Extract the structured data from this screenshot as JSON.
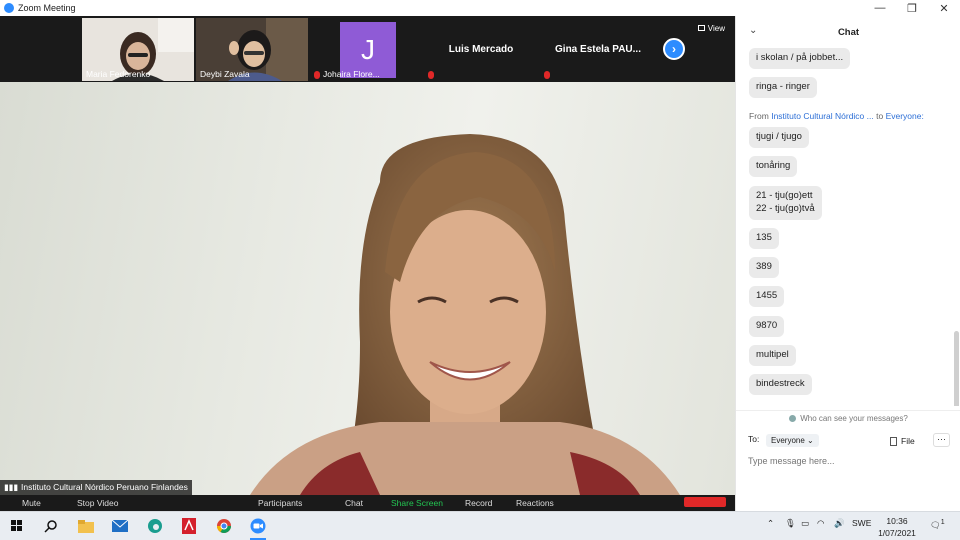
{
  "window": {
    "title": "Zoom Meeting",
    "minimize": "—",
    "restore": "❐",
    "close": "✕"
  },
  "thumbnails": [
    {
      "name": "Maria Fedorenko"
    },
    {
      "name": "Deybi Zavala"
    },
    {
      "name": "Johaira Flore...",
      "initial": "J"
    },
    {
      "name": "Luis Mercado"
    },
    {
      "name": "Gina Estela PAU..."
    }
  ],
  "view_label": "View",
  "speaker_name": "Instituto Cultural Nórdico Peruano Finlandes",
  "toolbar": {
    "mute": "Mute",
    "stop_video": "Stop Video",
    "participants": "Participants",
    "chat": "Chat",
    "share_screen": "Share Screen",
    "record": "Record",
    "reactions": "Reactions"
  },
  "chat": {
    "title": "Chat",
    "messages_top": [
      "i skolan / på jobbet...",
      "ringa - ringer"
    ],
    "from_prefix": "From",
    "from_sender": "Instituto Cultural Nórdico ...",
    "from_to": "to",
    "from_recipient": "Everyone:",
    "messages": [
      "tjugi / tjugo",
      "tonåring",
      "21 - tju(go)ett\n22 - tju(go)två",
      "135",
      "389",
      "1455",
      "9870",
      "multipel",
      "bindestreck"
    ],
    "who_can_see": "Who can see your messages?",
    "to_label": "To:",
    "recipient": "Everyone",
    "file_label": "File",
    "more_label": "···",
    "input_placeholder": "Type message here..."
  },
  "taskbar": {
    "language": "SWE",
    "time": "10:36",
    "date": "1/07/2021",
    "notifications": "1"
  }
}
